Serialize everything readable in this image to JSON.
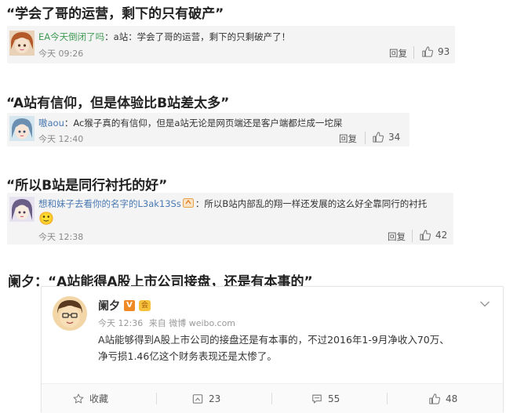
{
  "section1": {
    "heading": "“学会了哥的运营，剩下的只有破产”",
    "username": "EA今天倒闭了吗",
    "text": "：a站：学会了哥的运营，剩下的只剩破产了！",
    "time": "今天 09:26",
    "reply": "回复",
    "likes": "93"
  },
  "section2": {
    "heading": "“A站有信仰，但是体验比B站差太多”",
    "username": "嗷aou",
    "text": "：Ac猴子真的有信仰，但是a站无论是网页端还是客户端都烂成一坨屎",
    "time": "今天 12:40",
    "reply": "回复",
    "likes": "34"
  },
  "section3": {
    "heading": "“所以B站是同行衬托的好”",
    "username": "想和妹子去看你的名字的L3ak13Ss",
    "text": "：所以B站内部乱的翔一样还发展的这么好全靠同行的衬托",
    "emoji": "🙂",
    "time": "今天 12:38",
    "reply": "回复",
    "likes": "42"
  },
  "section4": {
    "heading": "阑夕：“A站能得A股上市公司接盘，还是有本事的”",
    "post": {
      "author": "阑夕",
      "verified_badge": "V",
      "member_badge": "会",
      "time": "今天 12:36",
      "source": "来自 微博 weibo.com",
      "body_line1": "A站能够得到A股上市公司的接盘还是有本事的，不过2016年1-9月净收入70万、",
      "body_line2": "净亏损1.46亿这个财务表现还是太惨了。",
      "favorite_label": "收藏",
      "repost_count": "23",
      "comment_count": "55",
      "like_count": "48"
    }
  },
  "colors": {
    "username_blue": "#4a79b2",
    "username_green": "#3e9a53",
    "card_bg": "#f4f4f4",
    "verified_orange": "#f08a24"
  },
  "icons": [
    "thumbs-up-icon",
    "star-icon",
    "repost-icon",
    "comment-icon",
    "chevron-down-icon",
    "verified-icon",
    "member-badge-icon"
  ]
}
